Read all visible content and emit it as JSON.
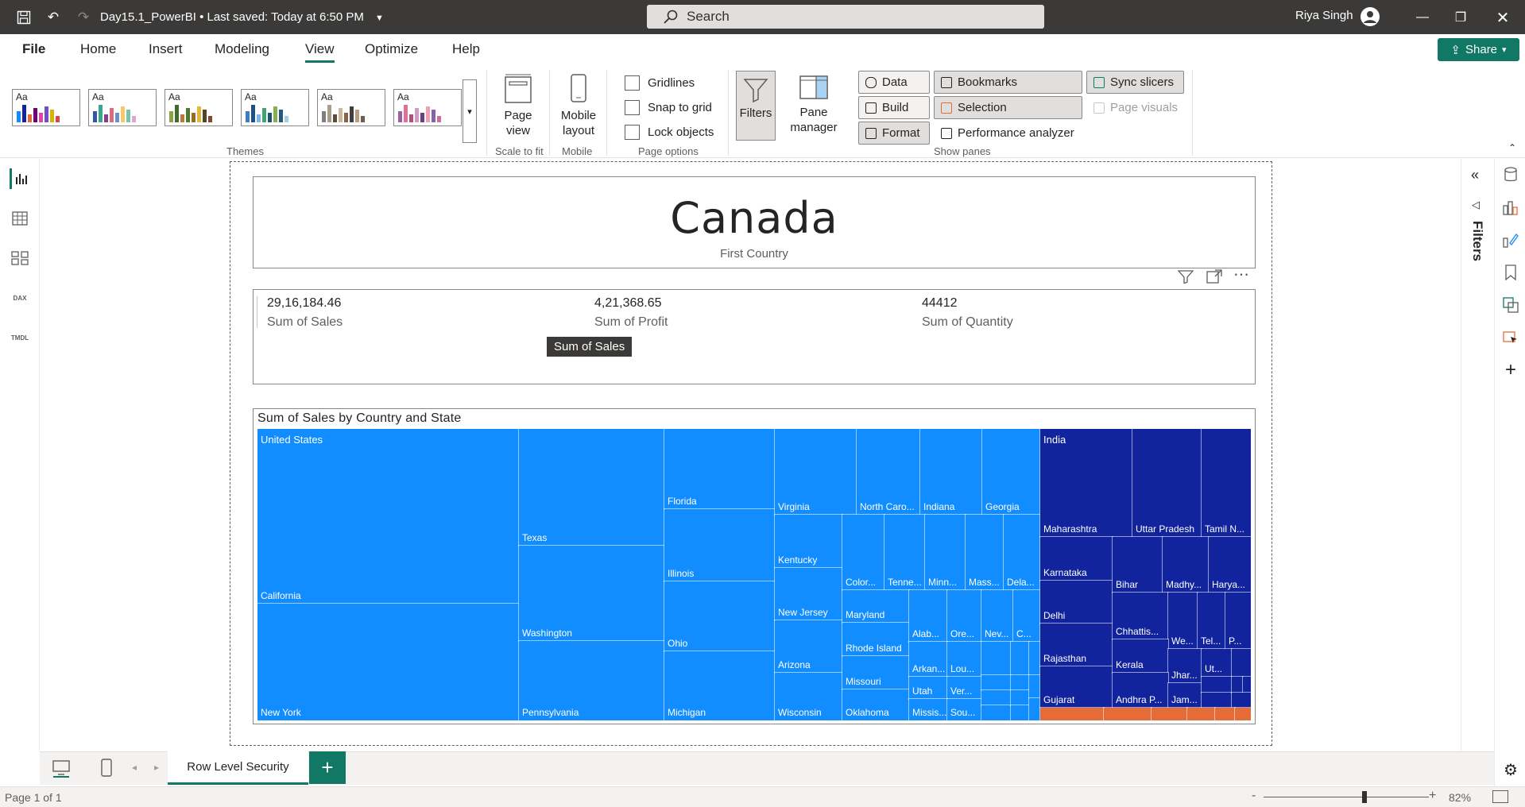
{
  "titlebar": {
    "document_title": "Day15.1_PowerBI",
    "saved_status": "Last saved: Today at 6:50 PM",
    "search_placeholder": "Search",
    "user_name": "Riya Singh"
  },
  "menu": {
    "file": "File",
    "home": "Home",
    "insert": "Insert",
    "modeling": "Modeling",
    "view": "View",
    "optimize": "Optimize",
    "help": "Help",
    "share": "Share"
  },
  "ribbon": {
    "themes_label": "Themes",
    "theme_aa": "Aa",
    "page_view": "Page view",
    "scale_to_fit": "Scale to fit",
    "mobile_layout": "Mobile layout",
    "mobile_label": "Mobile",
    "gridlines": "Gridlines",
    "snap_to_grid": "Snap to grid",
    "lock_objects": "Lock objects",
    "page_options_label": "Page options",
    "filters": "Filters",
    "pane_manager": "Pane manager",
    "data": "Data",
    "build": "Build",
    "format": "Format",
    "bookmarks": "Bookmarks",
    "selection": "Selection",
    "performance_analyzer": "Performance analyzer",
    "sync_slicers": "Sync slicers",
    "page_visuals": "Page visuals",
    "show_panes_label": "Show panes"
  },
  "theme_palettes": [
    [
      "#118dff",
      "#12239e",
      "#e66c37",
      "#6b007b",
      "#e044a7",
      "#744ec2",
      "#d9b300",
      "#d64550"
    ],
    [
      "#3257a8",
      "#37a794",
      "#8b3d88",
      "#dd6b7f",
      "#6b91c9",
      "#f5c869",
      "#77c4a8",
      "#dea6cf"
    ],
    [
      "#8ba348",
      "#3f6c2e",
      "#b67a39",
      "#4c7d2d",
      "#9b6a25",
      "#e2b93b",
      "#51471f",
      "#7d4b2b"
    ],
    [
      "#3a7dc9",
      "#1e4f8a",
      "#7ab8e3",
      "#41a36f",
      "#16586f",
      "#86b04e",
      "#29567c",
      "#a4cde6"
    ],
    [
      "#7f7f7f",
      "#a99e8c",
      "#5b4a3e",
      "#c9b99a",
      "#87644b",
      "#3f3f3f",
      "#b7a082",
      "#6e5d50"
    ],
    [
      "#9d5fa0",
      "#e26f99",
      "#b14e7c",
      "#d29bc5",
      "#6d3c82",
      "#f09fb5",
      "#8466a6",
      "#cc6f9c"
    ]
  ],
  "report": {
    "country": "Canada",
    "country_label": "First Country",
    "kpis": [
      {
        "value": "29,16,184.46",
        "label": "Sum of Sales"
      },
      {
        "value": "4,21,368.65",
        "label": "Sum of Profit"
      },
      {
        "value": "44412",
        "label": "Sum of Quantity"
      }
    ],
    "tooltip": "Sum of Sales",
    "treemap_title": "Sum of Sales by Country and State"
  },
  "colors": {
    "us": "#118dff",
    "india": "#12239e",
    "third": "#e66c37",
    "accent": "#117865"
  },
  "chart_data": {
    "type": "treemap",
    "title": "Sum of Sales by Country and State",
    "groups": [
      {
        "name": "United States",
        "states": [
          "California",
          "New York",
          "Texas",
          "Washington",
          "Pennsylvania",
          "Florida",
          "Illinois",
          "Ohio",
          "Michigan",
          "Virginia",
          "North Caro...",
          "Indiana",
          "Georgia",
          "Kentucky",
          "New Jersey",
          "Arizona",
          "Wisconsin",
          "Color...",
          "Tenne...",
          "Minn...",
          "Mass...",
          "Dela...",
          "Maryland",
          "Rhode Island",
          "Missouri",
          "Oklahoma",
          "Alab...",
          "Ore...",
          "Nev...",
          "C...",
          "Arkan...",
          "Lou...",
          "Utah",
          "Ver...",
          "Missis...",
          "Sou..."
        ]
      },
      {
        "name": "India",
        "states": [
          "Maharashtra",
          "Uttar Pradesh",
          "Tamil N...",
          "Karnataka",
          "Delhi",
          "Rajasthan",
          "Gujarat",
          "Bihar",
          "Madhy...",
          "Harya...",
          "Chhattis...",
          "We...",
          "Tel...",
          "P...",
          "Kerala",
          "Jhar...",
          "Ut...",
          "Andhra P...",
          "Jam..."
        ]
      }
    ]
  },
  "tabs": {
    "page_name": "Row Level Security",
    "add": "+"
  },
  "status": {
    "page_info": "Page 1 of 1",
    "zoom": "82%",
    "zoom_minus": "-",
    "zoom_plus": "+"
  }
}
